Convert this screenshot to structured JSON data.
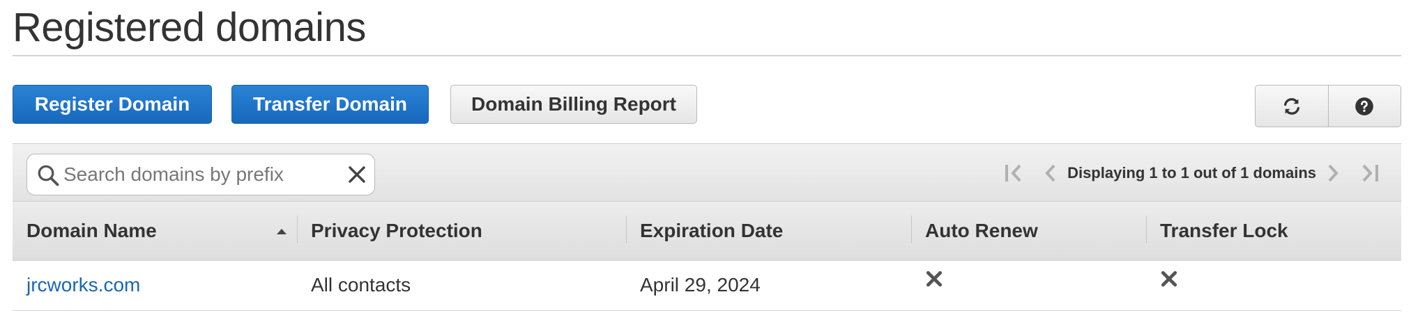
{
  "page": {
    "title": "Registered domains"
  },
  "actions": {
    "register_label": "Register Domain",
    "transfer_label": "Transfer Domain",
    "billing_label": "Domain Billing Report",
    "refresh_icon": "refresh-icon",
    "help_icon": "help-icon"
  },
  "search": {
    "placeholder": "Search domains by prefix",
    "value": ""
  },
  "pagination": {
    "text": "Displaying 1 to 1 out of 1 domains"
  },
  "table": {
    "columns": [
      {
        "label": "Domain Name",
        "sorted": "ascending"
      },
      {
        "label": "Privacy Protection"
      },
      {
        "label": "Expiration Date"
      },
      {
        "label": "Auto Renew"
      },
      {
        "label": "Transfer Lock"
      }
    ],
    "rows": [
      {
        "domain_name": "jrcworks.com",
        "privacy_protection": "All contacts",
        "expiration_date": "April 29, 2024",
        "auto_renew": "disabled-x-icon",
        "transfer_lock": "disabled-x-icon"
      }
    ]
  },
  "colors": {
    "primary_button": "#1f73c9",
    "link": "#1a66b8",
    "text": "#333333"
  }
}
